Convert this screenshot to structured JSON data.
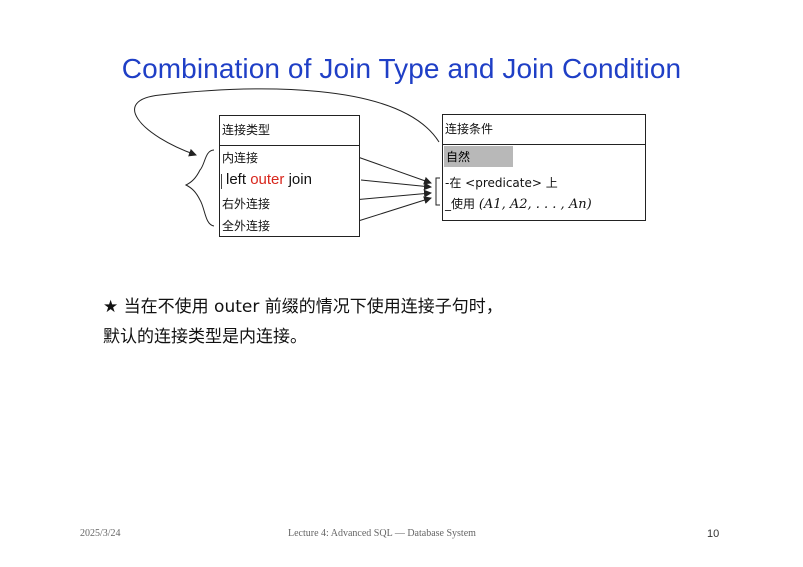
{
  "slide": {
    "title": "Combination of Join Type and Join Condition"
  },
  "join_type_table": {
    "header": "连接类型",
    "rows": {
      "inner": "内连接",
      "left_outer_prefix": "left",
      "left_outer_keyword": "outer",
      "left_outer_suffix": "join",
      "right_outer": "右外连接",
      "full_outer": "全外连接"
    }
  },
  "join_condition_table": {
    "header": "连接条件",
    "rows": {
      "natural": "自然",
      "on": "-在 <predicate> 上",
      "using_prefix": "_使用",
      "using_expr": "(A1, A2, . . . , An)"
    }
  },
  "note": {
    "line1": "★ 当在不使用 outer 前缀的情况下使用连接子句时，",
    "line2": "默认的连接类型是内连接。"
  },
  "footer": {
    "date": "2025/3/24",
    "course": "Lecture 4: Advanced SQL — Database System",
    "page": "10"
  },
  "colors": {
    "title": "#1f3fc6",
    "outer_keyword": "#d8261c",
    "natural_highlight": "#b8b8b8"
  }
}
